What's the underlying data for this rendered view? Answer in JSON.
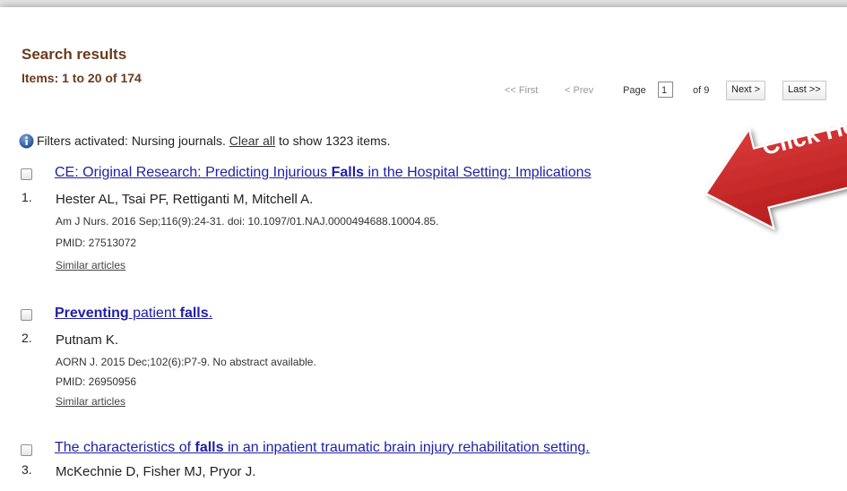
{
  "header": {
    "title": "Search results",
    "items_summary": "Items: 1 to 20 of 174"
  },
  "pager": {
    "first": "<< First",
    "prev": "< Prev",
    "page_label": "Page",
    "page_value": "1",
    "of_label": "of 9",
    "next": "Next >",
    "last": "Last >>"
  },
  "filters": {
    "icon": "info-icon",
    "prefix": "Filters activated: Nursing journals.",
    "clear_link": "Clear all",
    "suffix": "to show 1323 items."
  },
  "results": [
    {
      "number": "1.",
      "title_parts": [
        {
          "text": "CE: Original Research: Predicting Injurious ",
          "bold": false
        },
        {
          "text": "Falls",
          "bold": true
        },
        {
          "text": " in the Hospital Setting: Implications",
          "bold": false
        }
      ],
      "authors": "Hester AL, Tsai PF, Rettiganti M, Mitchell A.",
      "citation": "Am J Nurs. 2016 Sep;116(9):24-31. doi: 10.1097/01.NAJ.0000494688.10004.85.",
      "pmid": "PMID: 27513072",
      "similar": "Similar articles"
    },
    {
      "number": "2.",
      "title_parts": [
        {
          "text": "Preventing",
          "bold": true
        },
        {
          "text": " patient ",
          "bold": false
        },
        {
          "text": "falls",
          "bold": true
        },
        {
          "text": ".",
          "bold": false
        }
      ],
      "authors": "Putnam K.",
      "citation": "AORN J. 2015 Dec;102(6):P7-9. No abstract available.",
      "pmid": "PMID: 26950956",
      "similar": "Similar articles"
    },
    {
      "number": "3.",
      "title_parts": [
        {
          "text": "The characteristics of ",
          "bold": false
        },
        {
          "text": "falls",
          "bold": true
        },
        {
          "text": " in an inpatient traumatic brain injury rehabilitation setting.",
          "bold": false
        }
      ],
      "authors": "McKechnie D, Fisher MJ, Pryor J.",
      "citation": "",
      "pmid": "",
      "similar": ""
    }
  ],
  "callout": {
    "text": "Click Here",
    "color": "#c62828"
  },
  "colors": {
    "heading": "#6b3a1e",
    "link": "#2020a8"
  }
}
